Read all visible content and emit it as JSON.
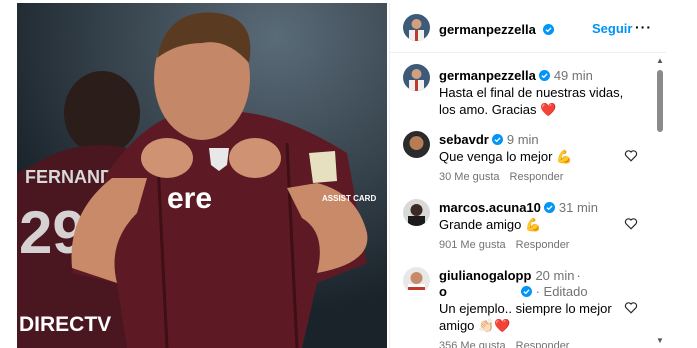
{
  "header": {
    "username": "germanpezzella",
    "follow_label": "Seguir",
    "more_label": "···"
  },
  "caption": {
    "username": "germanpezzella",
    "time": "49 min",
    "text": "Hasta el final de nuestras vidas, los amo. Gracias ❤️"
  },
  "comments": [
    {
      "username": "sebavdr",
      "verified": true,
      "time": "9 min",
      "text": "Que venga lo mejor 💪",
      "likes": "30 Me gusta",
      "reply": "Responder"
    },
    {
      "username": "marcos.acuna10",
      "verified": true,
      "time": "31 min",
      "text": "Grande amigo 💪",
      "likes": "901 Me gusta",
      "reply": "Responder"
    },
    {
      "username_line1": "giulianogalopp",
      "username_line2": "o",
      "verified": true,
      "time": "20 min",
      "edited": "· Editado",
      "text": "Un ejemplo.. siempre lo mejor amigo 👏🏻❤️",
      "likes": "356 Me gusta",
      "reply": "Responder"
    }
  ],
  "photo": {
    "jersey_text": "ere",
    "back_name": "FERNANDE",
    "ad_text": "DIRECTV",
    "sleeve_text": "ASSIST CARD"
  },
  "colors": {
    "accent_blue": "#0095f6",
    "verified_blue": "#0095f6",
    "meta_gray": "#737373",
    "jersey": "#5e1a24"
  }
}
